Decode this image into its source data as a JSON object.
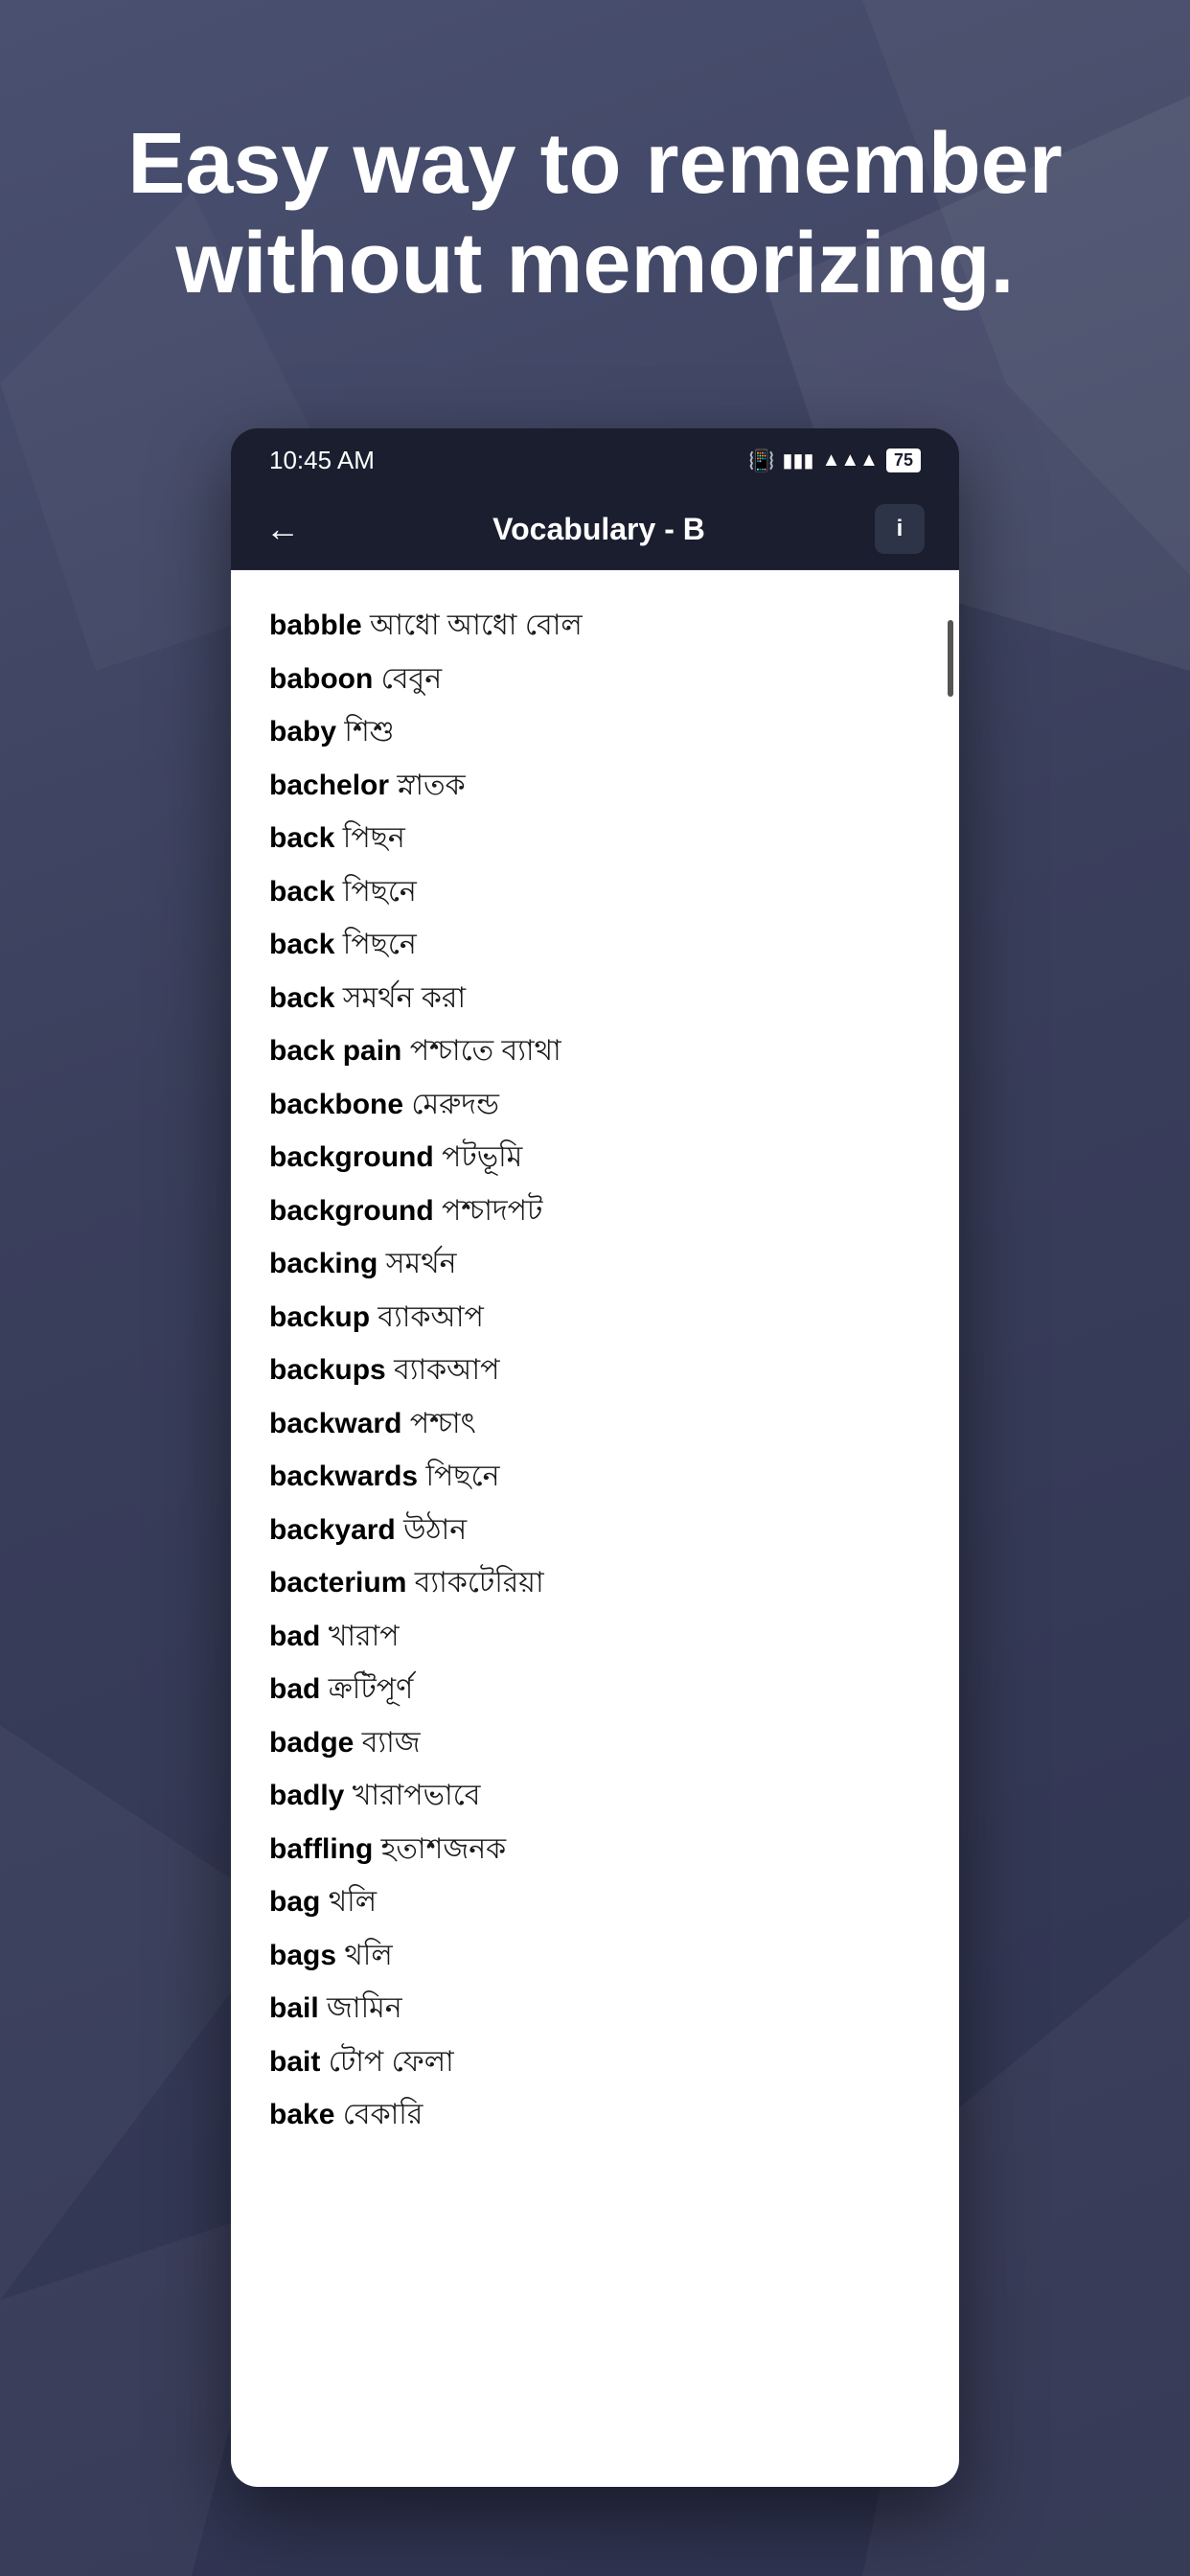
{
  "hero": {
    "title": "Easy way to remember without memorizing."
  },
  "status_bar": {
    "time": "10:45 AM",
    "battery": "75"
  },
  "app_bar": {
    "title": "Vocabulary - B",
    "back_label": "←",
    "info_label": "i"
  },
  "vocabulary": [
    {
      "en": "babble",
      "bn": "আধো আধো বোল"
    },
    {
      "en": "baboon",
      "bn": "বেবুন"
    },
    {
      "en": "baby",
      "bn": "শিশু"
    },
    {
      "en": "bachelor",
      "bn": "স্নাতক"
    },
    {
      "en": "back",
      "bn": "পিছন"
    },
    {
      "en": "back",
      "bn": "পিছনে"
    },
    {
      "en": "back",
      "bn": "পিছনে"
    },
    {
      "en": "back",
      "bn": "সমর্থন করা"
    },
    {
      "en": "back pain",
      "bn": "পশ্চাতে ব্যাথা"
    },
    {
      "en": "backbone",
      "bn": "মেরুদন্ড"
    },
    {
      "en": "background",
      "bn": "পটভূমি"
    },
    {
      "en": "background",
      "bn": "পশ্চাদপট"
    },
    {
      "en": "backing",
      "bn": "সমর্থন"
    },
    {
      "en": "backup",
      "bn": "ব্যাকআপ"
    },
    {
      "en": "backups",
      "bn": "ব্যাকআপ"
    },
    {
      "en": "backward",
      "bn": "পশ্চাৎ"
    },
    {
      "en": "backwards",
      "bn": "পিছনে"
    },
    {
      "en": "backyard",
      "bn": "উঠান"
    },
    {
      "en": "bacterium",
      "bn": "ব্যাকটেরিয়া"
    },
    {
      "en": "bad",
      "bn": "খারাপ"
    },
    {
      "en": "bad",
      "bn": "ক্রটিপূর্ণ"
    },
    {
      "en": "badge",
      "bn": "ব্যাজ"
    },
    {
      "en": "badly",
      "bn": "খারাপভাবে"
    },
    {
      "en": "baffling",
      "bn": "হতাশজনক"
    },
    {
      "en": "bag",
      "bn": "থলি"
    },
    {
      "en": "bags",
      "bn": "থলি"
    },
    {
      "en": "bail",
      "bn": "জামিন"
    },
    {
      "en": "bait",
      "bn": "টোপ ফেলা"
    },
    {
      "en": "bake",
      "bn": "বেকারি"
    }
  ]
}
